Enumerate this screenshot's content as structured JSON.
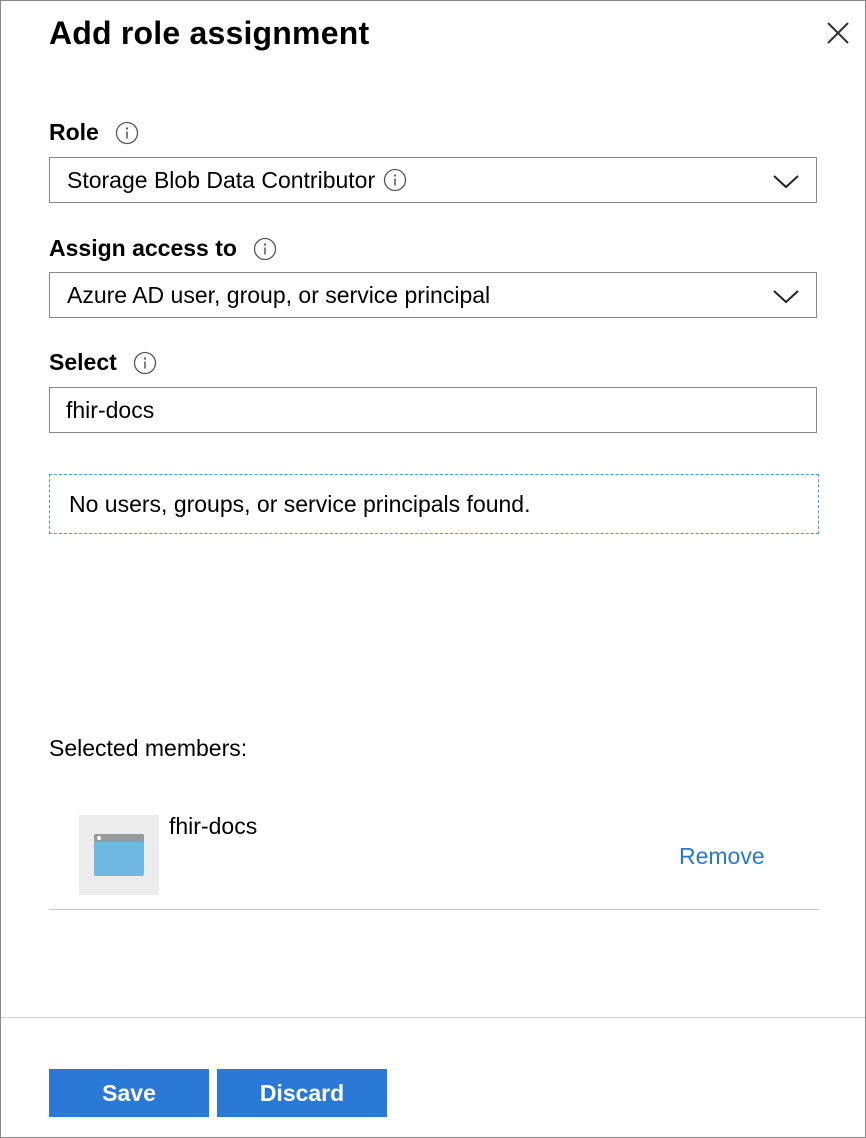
{
  "dialog": {
    "title": "Add role assignment"
  },
  "role": {
    "label": "Role",
    "value": "Storage Blob Data Contributor"
  },
  "assign_access": {
    "label": "Assign access to",
    "value": "Azure AD user, group, or service principal"
  },
  "select": {
    "label": "Select",
    "value": "fhir-docs"
  },
  "results": {
    "message": "No users, groups, or service principals found."
  },
  "selected_members": {
    "heading": "Selected members:",
    "items": [
      {
        "name": "fhir-docs",
        "remove_label": "Remove",
        "icon": "app-window-icon"
      }
    ]
  },
  "footer": {
    "save_label": "Save",
    "discard_label": "Discard"
  },
  "colors": {
    "primary_button": "#2b79d6",
    "link": "#2b78d0",
    "dashed_border": "#3aa0d8"
  }
}
